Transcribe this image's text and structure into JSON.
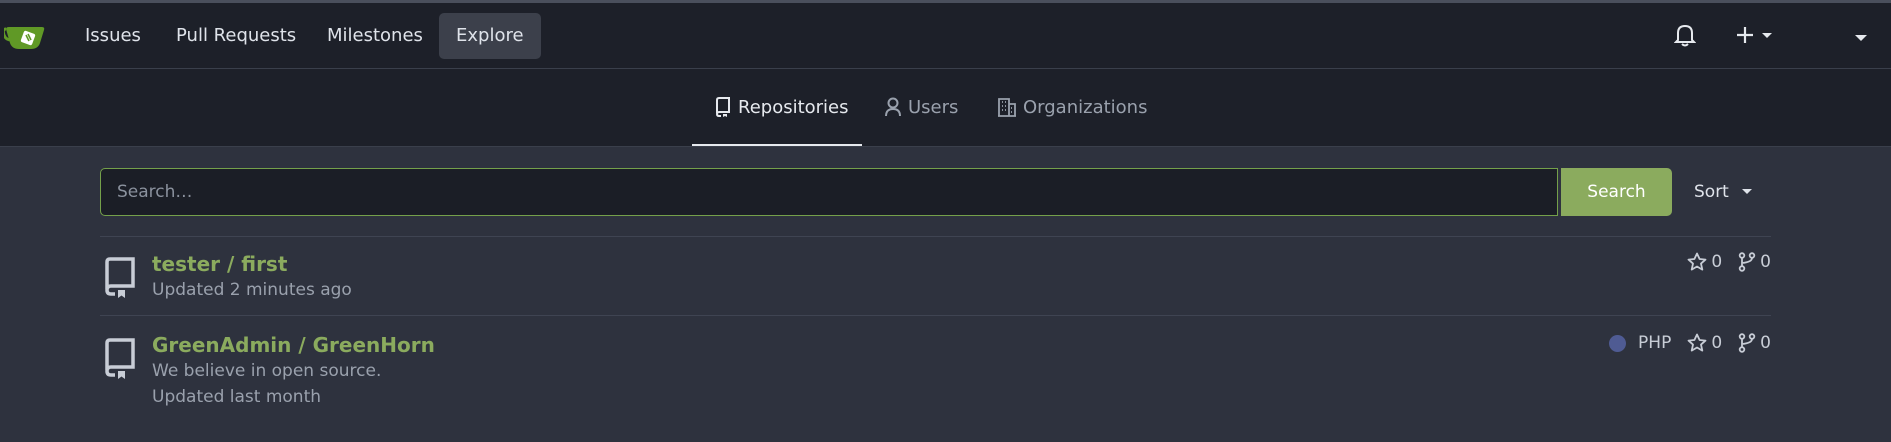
{
  "navbar": {
    "items": [
      {
        "label": "Issues"
      },
      {
        "label": "Pull Requests"
      },
      {
        "label": "Milestones"
      },
      {
        "label": "Explore"
      }
    ]
  },
  "tabs": [
    {
      "label": "Repositories"
    },
    {
      "label": "Users"
    },
    {
      "label": "Organizations"
    }
  ],
  "search": {
    "placeholder": "Search…",
    "value": "",
    "button_label": "Search",
    "sort_label": "Sort"
  },
  "repos": [
    {
      "owner_name": "tester / first",
      "description": "",
      "updated": "Updated 2 minutes ago",
      "language": "",
      "stars": "0",
      "forks": "0"
    },
    {
      "owner_name": "GreenAdmin / GreenHorn",
      "description": "We believe in open source.",
      "updated": "Updated last month",
      "language": "PHP",
      "language_color": "#4f5b93",
      "stars": "0",
      "forks": "0"
    }
  ],
  "colors": {
    "accent": "#8bab5e",
    "navbar_bg": "#1d2029",
    "page_bg": "#2e323e"
  }
}
